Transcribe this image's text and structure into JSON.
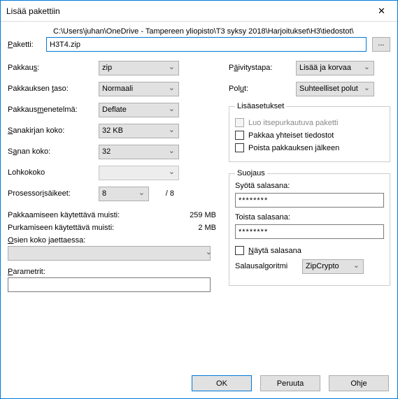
{
  "title": "Lisää pakettiin",
  "path_label": "Paketti:",
  "path_dir": "C:\\Users\\juhan\\OneDrive - Tampereen yliopisto\\T3 syksy 2018\\Harjoitukset\\H3\\tiedostot\\",
  "path_file": "H3T4.zip",
  "browse": "...",
  "left": {
    "format_label": "Pakkaus:",
    "format_value": "zip",
    "level_label": "Pakkauksen taso:",
    "level_value": "Normaali",
    "method_label": "Pakkausmenetelmä:",
    "method_value": "Deflate",
    "dict_label": "Sanakirjan koko:",
    "dict_value": "32 KB",
    "word_label": "Sanan koko:",
    "word_value": "32",
    "block_label": "Lohkokoko",
    "block_value": "",
    "threads_label": "Prosessorisäikeet:",
    "threads_value": "8",
    "threads_total": "/ 8",
    "mem_pack_label": "Pakkaamiseen käytettävä muisti:",
    "mem_pack_value": "259 MB",
    "mem_unpack_label": "Purkamiseen käytettävä muisti:",
    "mem_unpack_value": "2 MB",
    "split_label": "Osien koko jaettaessa:",
    "params_label": "Parametrit:"
  },
  "right": {
    "update_label": "Päivitystapa:",
    "update_value": "Lisää ja korvaa",
    "paths_label": "Polut:",
    "paths_value": "Suhteelliset polut",
    "options_legend": "Lisäasetukset",
    "sfx_label": "Luo itsepurkautuva paketti",
    "shared_label": "Pakkaa yhteiset tiedostot",
    "delete_label": "Poista pakkauksen jälkeen",
    "encryption_legend": "Suojaus",
    "pwd1_label": "Syötä salasana:",
    "pwd1_value": "********",
    "pwd2_label": "Toista salasana:",
    "pwd2_value": "********",
    "showpwd_label": "Näytä salasana",
    "algo_label": "Salausalgoritmi",
    "algo_value": "ZipCrypto"
  },
  "footer": {
    "ok": "OK",
    "cancel": "Peruuta",
    "help": "Ohje"
  }
}
